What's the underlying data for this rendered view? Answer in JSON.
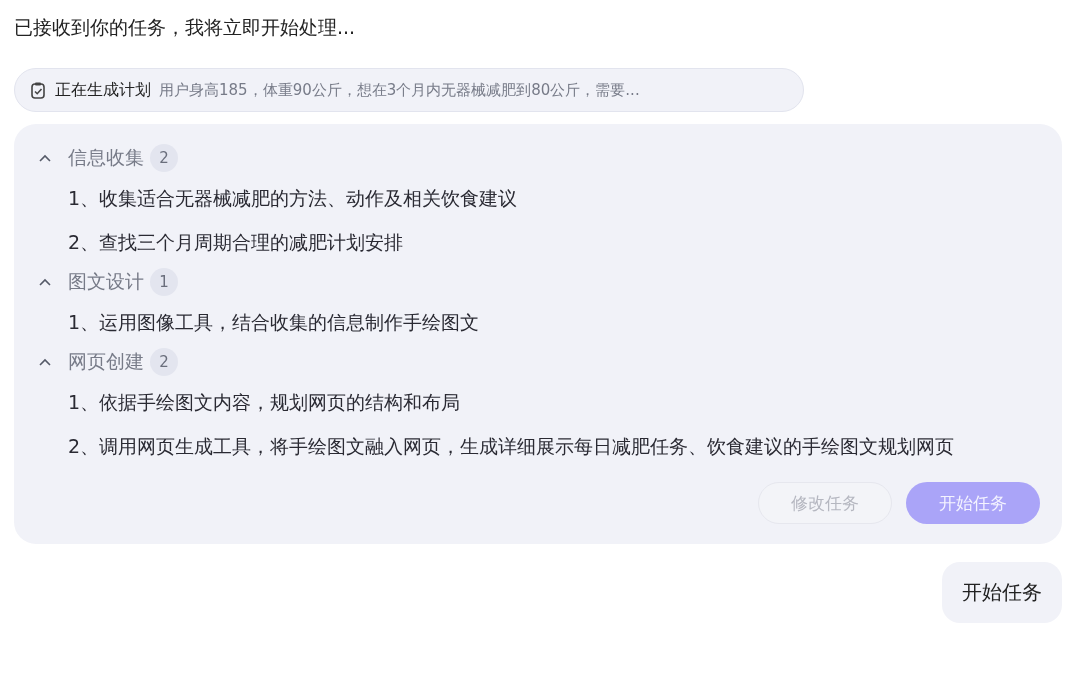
{
  "intro": "已接收到你的任务，我将立即开始处理...",
  "status": {
    "label": "正在生成计划",
    "summary": "用户身高185，体重90公斤，想在3个月内无器械减肥到80公斤，需要..."
  },
  "plan": {
    "sections": [
      {
        "title": "信息收集",
        "count": "2",
        "expanded": true,
        "items": [
          "1、收集适合无器械减肥的方法、动作及相关饮食建议",
          "2、查找三个月周期合理的减肥计划安排"
        ]
      },
      {
        "title": "图文设计",
        "count": "1",
        "expanded": true,
        "items": [
          "1、运用图像工具，结合收集的信息制作手绘图文"
        ]
      },
      {
        "title": "网页创建",
        "count": "2",
        "expanded": true,
        "items": [
          "1、依据手绘图文内容，规划网页的结构和布局",
          "2、调用网页生成工具，将手绘图文融入网页，生成详细展示每日减肥任务、饮食建议的手绘图文规划网页"
        ]
      }
    ],
    "buttons": [
      {
        "label": "修改任务",
        "kind": "secondary",
        "disabled": true
      },
      {
        "label": "开始任务",
        "kind": "primary",
        "disabled": true
      }
    ]
  },
  "user_message": "开始任务"
}
